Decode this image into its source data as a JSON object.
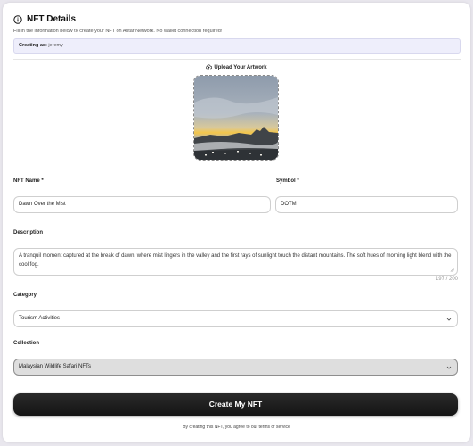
{
  "header": {
    "title": "NFT Details",
    "subtitle": "Fill in the information below to create your NFT on Astar Network. No wallet connection required!"
  },
  "creating": {
    "label": "Creating as:",
    "user": "jeremy"
  },
  "upload": {
    "label": "Upload Your Artwork"
  },
  "fields": {
    "name_label": "NFT Name *",
    "name_value": "Dawn Over the Mist",
    "symbol_label": "Symbol *",
    "symbol_value": "DOTM",
    "description_label": "Description",
    "description_value": "A tranquil moment captured at the break of dawn, where mist lingers in the valley and the first rays of sunlight touch the distant mountains. The soft hues of morning light blend with the cool fog.",
    "description_counter": "197 / 200",
    "category_label": "Category",
    "category_value": "Tourism Activities",
    "collection_label": "Collection",
    "collection_value": "Malaysian Wildlife Safari NFTs"
  },
  "actions": {
    "create_label": "Create My NFT",
    "terms": "By creating this NFT, you agree to our terms of service"
  },
  "colors": {
    "button": "#1c1c1c",
    "creating_bg": "#eeeefb",
    "disabled_select_bg": "#dedede"
  },
  "icons": {
    "header": "info-icon",
    "upload": "cloud-upload-icon",
    "select": "chevron-down-icon"
  }
}
